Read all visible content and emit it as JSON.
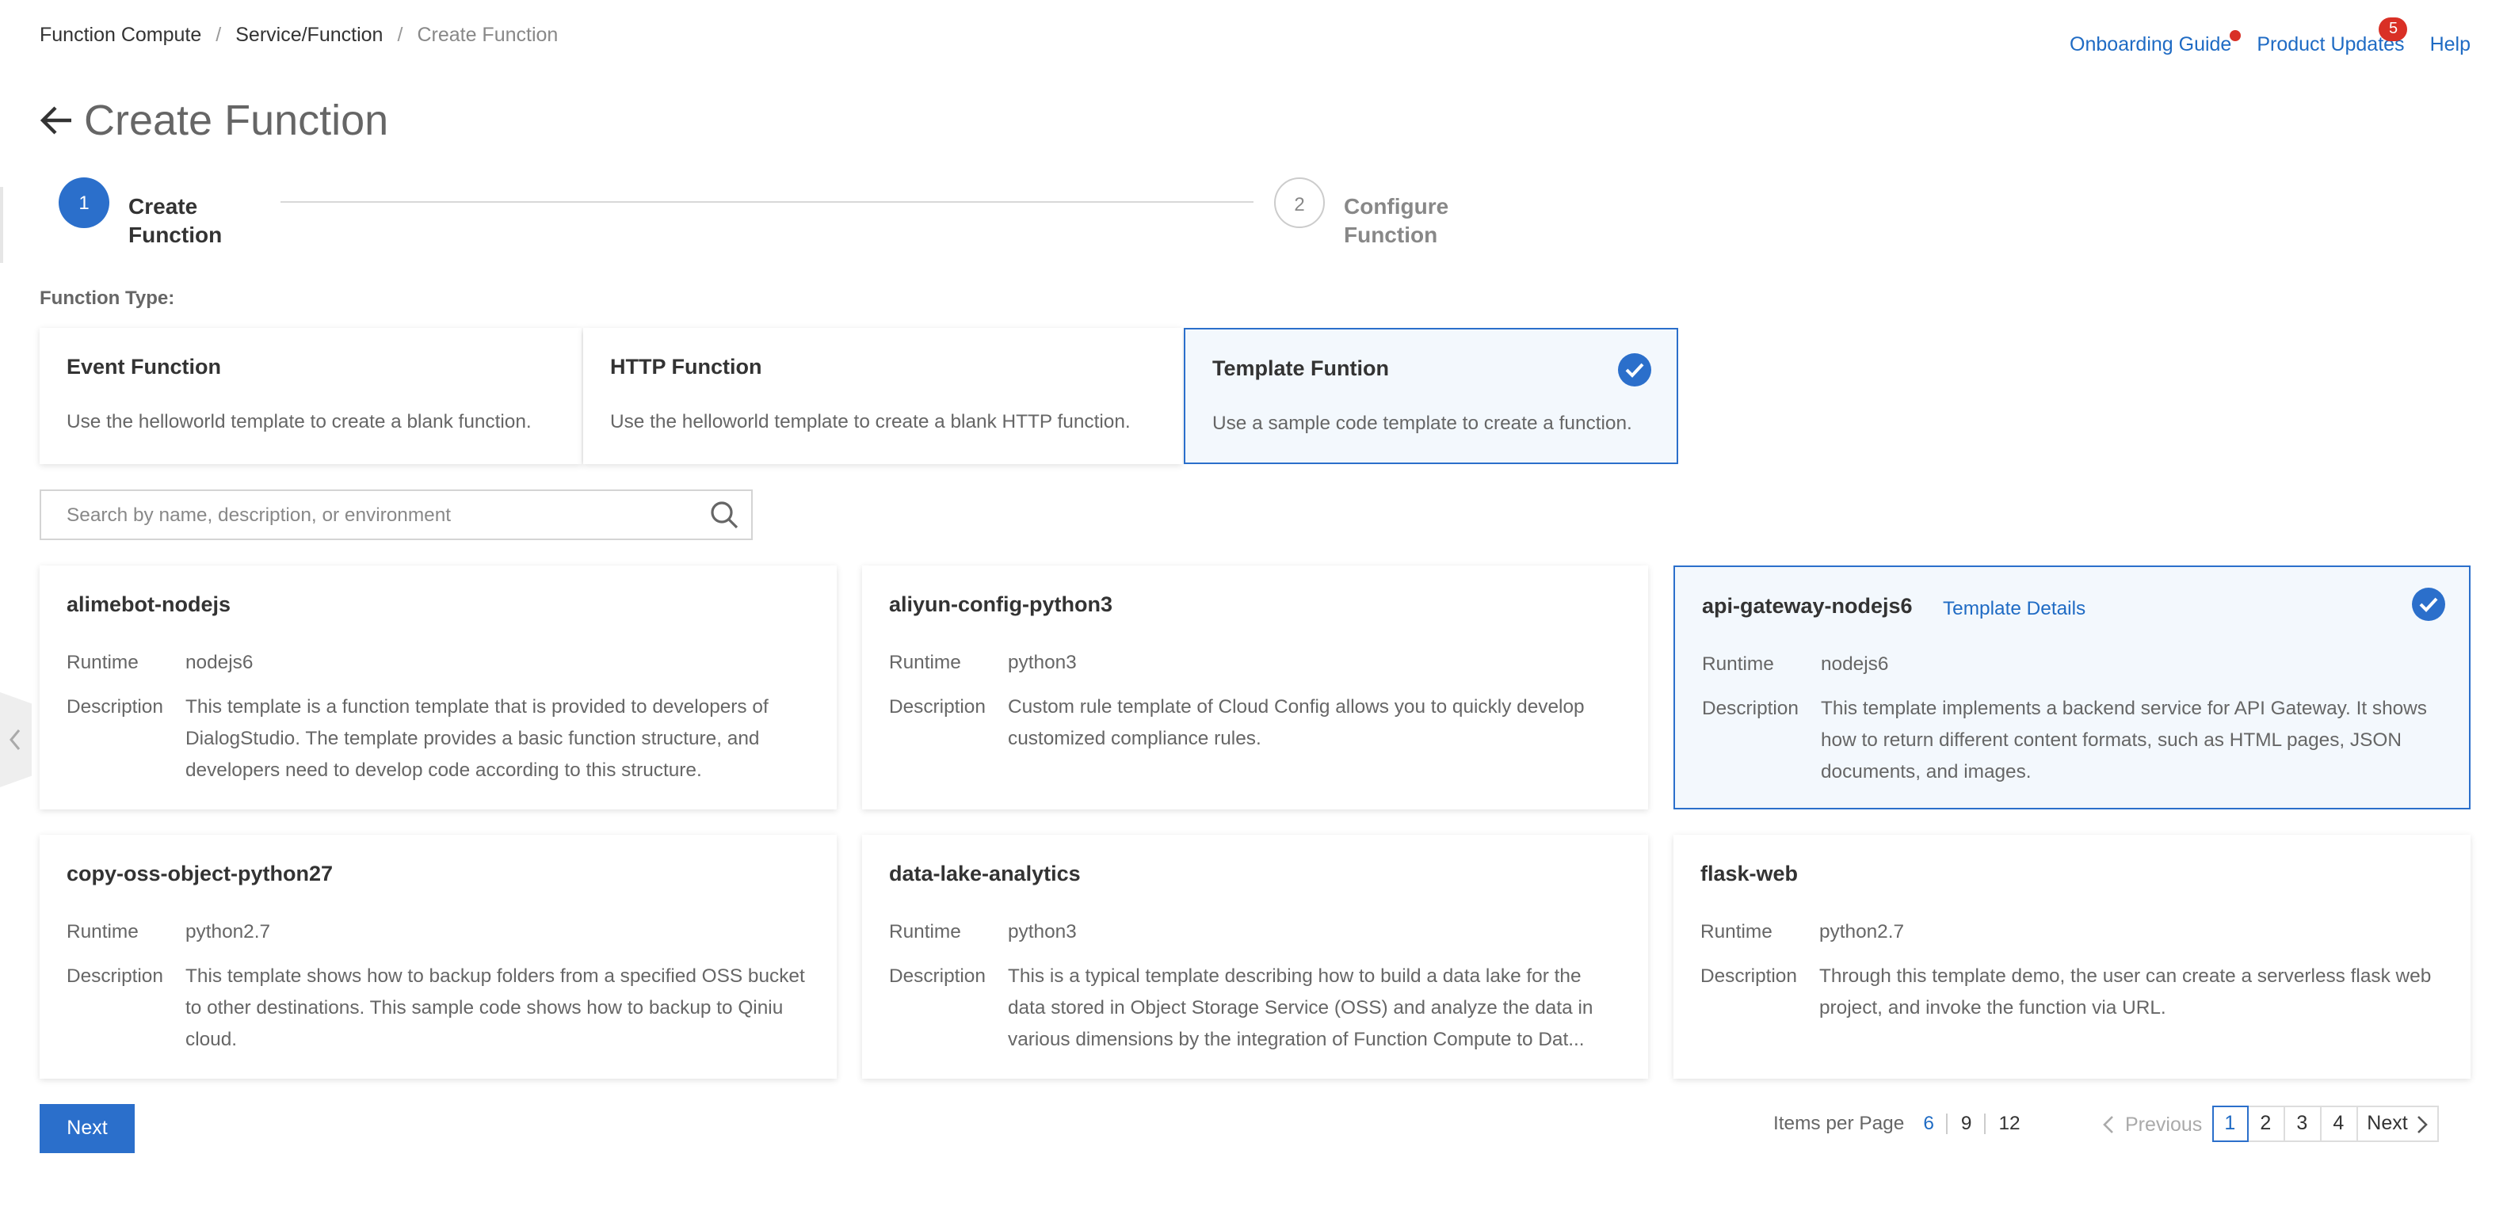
{
  "breadcrumb": {
    "items": [
      "Function Compute",
      "Service/Function"
    ],
    "separator": "/",
    "current": "Create Function"
  },
  "top_links": {
    "onboarding": "Onboarding Guide",
    "updates": "Product Updates",
    "updates_count": "5",
    "help": "Help"
  },
  "page": {
    "title": "Create Function"
  },
  "steps": [
    {
      "number": "1",
      "label": "Create Function",
      "state": "active"
    },
    {
      "number": "2",
      "label": "Configure Function",
      "state": "pending"
    }
  ],
  "function_type": {
    "label": "Function Type:",
    "options": [
      {
        "title": "Event Function",
        "description": "Use the helloworld template to create a blank function.",
        "selected": false
      },
      {
        "title": "HTTP Function",
        "description": "Use the helloworld template to create a blank HTTP function.",
        "selected": false
      },
      {
        "title": "Template Funtion",
        "description": "Use a sample code template to create a function.",
        "selected": true
      }
    ]
  },
  "search": {
    "placeholder": "Search by name, description, or environment",
    "value": "",
    "icon": "search-icon"
  },
  "templates": {
    "runtime_label": "Runtime",
    "description_label": "Description",
    "details_link": "Template Details",
    "items": [
      {
        "name": "alimebot-nodejs",
        "runtime": "nodejs6",
        "description": "This template is a function template that is provided to developers of DialogStudio. The template provides a basic function structure, and developers need to develop code according to this structure.",
        "selected": false
      },
      {
        "name": "aliyun-config-python3",
        "runtime": "python3",
        "description": "Custom rule template of Cloud Config allows you to quickly develop customized compliance rules.",
        "selected": false
      },
      {
        "name": "api-gateway-nodejs6",
        "runtime": "nodejs6",
        "description": "This template implements a backend service for API Gateway. It shows how to return different content formats, such as HTML pages, JSON documents, and images.",
        "selected": true
      },
      {
        "name": "copy-oss-object-python27",
        "runtime": "python2.7",
        "description": "This template shows how to backup folders from a specified OSS bucket to other destinations. This sample code shows how to backup to Qiniu cloud.",
        "selected": false
      },
      {
        "name": "data-lake-analytics",
        "runtime": "python3",
        "description": "This is a typical template describing how to build a data lake for the data stored in Object Storage Service (OSS) and analyze the data in various dimensions by the integration of Function Compute to Dat...",
        "selected": false
      },
      {
        "name": "flask-web",
        "runtime": "python2.7",
        "description": "Through this template demo, the user can create a serverless flask web project, and invoke the function via URL.",
        "selected": false
      }
    ]
  },
  "footer": {
    "next_button": "Next",
    "items_per_page_label": "Items per Page",
    "items_per_page_options": [
      "6",
      "9",
      "12"
    ],
    "items_per_page_selected": "6",
    "pagination": {
      "previous": "Previous",
      "pages": [
        "1",
        "2",
        "3",
        "4"
      ],
      "current": "1",
      "next": "Next"
    }
  },
  "colors": {
    "primary": "#2b6fcb",
    "link": "#1f6bc4",
    "badge": "#d93026",
    "selected_bg": "#f3f8fd"
  }
}
